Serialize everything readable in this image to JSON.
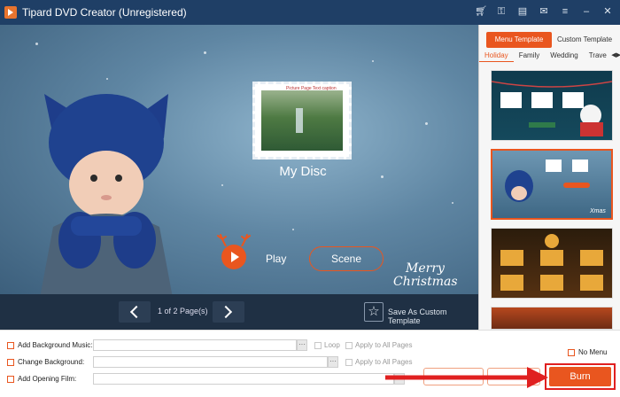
{
  "app": {
    "title": "Tipard DVD Creator (Unregistered)",
    "toolbar_icons": [
      "cart-icon",
      "key-icon",
      "file-icon",
      "feedback-icon",
      "menu-icon",
      "minimize-icon",
      "close-icon"
    ]
  },
  "preview": {
    "stamp_caption": "Picture Page Text caption",
    "disc_title": "My Disc",
    "play_label": "Play",
    "scene_label": "Scene",
    "greeting_line1": "Merry",
    "greeting_line2": "Christmas"
  },
  "pager": {
    "page_text": "1 of 2 Page(s)",
    "save_template_label": "Save As Custom Template"
  },
  "sidebar": {
    "tabs": [
      "Menu Template",
      "Custom Template"
    ],
    "active_tab": "Menu Template",
    "categories": [
      "Holiday",
      "Family",
      "Wedding",
      "Trave"
    ],
    "active_category": "Holiday",
    "selected_thumb": 2
  },
  "options": {
    "bg_music_label": "Add Background Music:",
    "bg_music_value": "",
    "loop_label": "Loop",
    "apply_all_label": "Apply to All Pages",
    "change_bg_label": "Change Background:",
    "change_bg_value": "",
    "apply_all_label2": "Apply to All Pages",
    "opening_film_label": "Add Opening Film:",
    "opening_film_value": "",
    "no_menu_label": "No Menu",
    "browse_label": "···"
  },
  "burn": {
    "label": "Burn"
  },
  "colors": {
    "accent": "#e9561f",
    "titlebar": "#1f3f66",
    "pager_bar": "#1f3044",
    "highlight": "#e02020"
  }
}
